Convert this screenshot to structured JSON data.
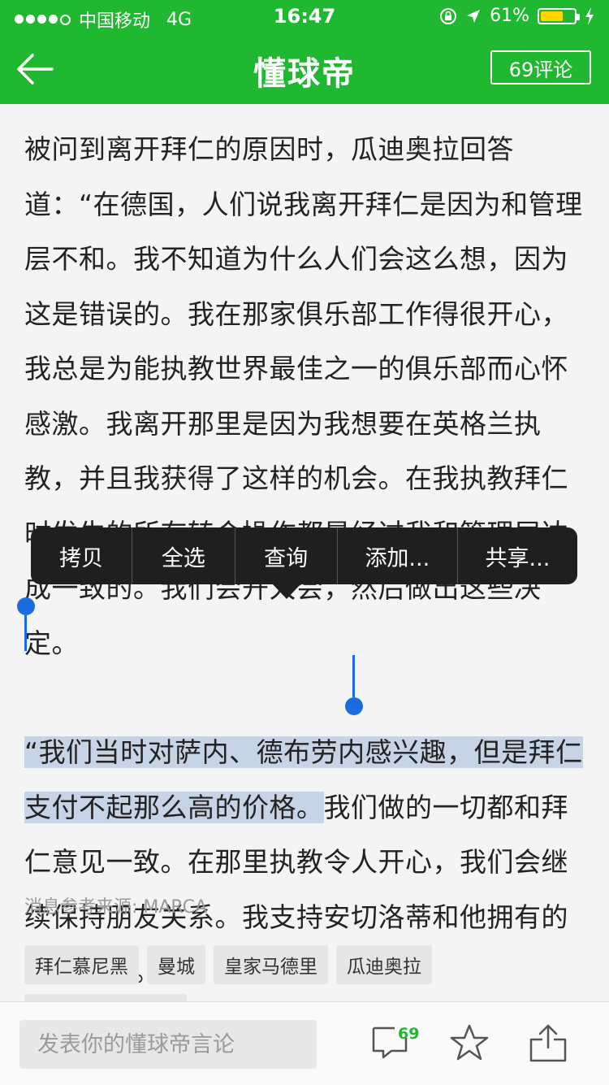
{
  "status_bar": {
    "carrier": "中国移动",
    "network": "4G",
    "time": "16:47",
    "battery_percent": "61%",
    "battery_level": 0.61,
    "signal_bars_filled": 4,
    "signal_bars_total": 5
  },
  "navbar": {
    "title": "懂球帝",
    "comments_label": "69评论",
    "accent_color": "#20b830"
  },
  "article": {
    "para1": "被问到离开拜仁的原因时，瓜迪奥拉回答道：“在德国，人们说我离开拜仁是因为和管理层不和。我不知道为什么人们会这么想，因为这是错误的。我在那家俱乐部工作得很开心，我总是为能执教世界最佳之一的俱乐部而心怀感激。我离开那里是因为我想要在英格兰执教，并且我获得了这样的机会。在我执教拜仁时发生的所有转会操作都是经过我和管理层达成一致的。我们会开大会，然后做出这些决定。",
    "para2_selected": "“我们当时对萨内、德布劳内感兴趣，但是拜仁支付不起那么高的价格。",
    "para2_rest": "我们做的一切都和拜仁意见一致。在那里执教令人开心，我们会继续保持朋友关系。我支持安切洛蒂和他拥有的出色球员。”",
    "source": "消息参考来源: MARCA",
    "tags": [
      "拜仁慕尼黑",
      "曼城",
      "皇家马德里",
      "瓜迪奥拉"
    ]
  },
  "context_menu": {
    "items": [
      "拷贝",
      "全选",
      "查询",
      "添加...",
      "共享..."
    ]
  },
  "bottom_bar": {
    "input_placeholder": "发表你的懂球帝言论",
    "comment_count": "69"
  },
  "icons": {
    "back": "back-arrow-icon",
    "location": "location-arrow-icon",
    "lock_rotation": "rotation-lock-icon",
    "charging": "charging-bolt-icon",
    "comment": "comment-bubble-icon",
    "favorite": "star-icon",
    "share": "share-icon"
  }
}
